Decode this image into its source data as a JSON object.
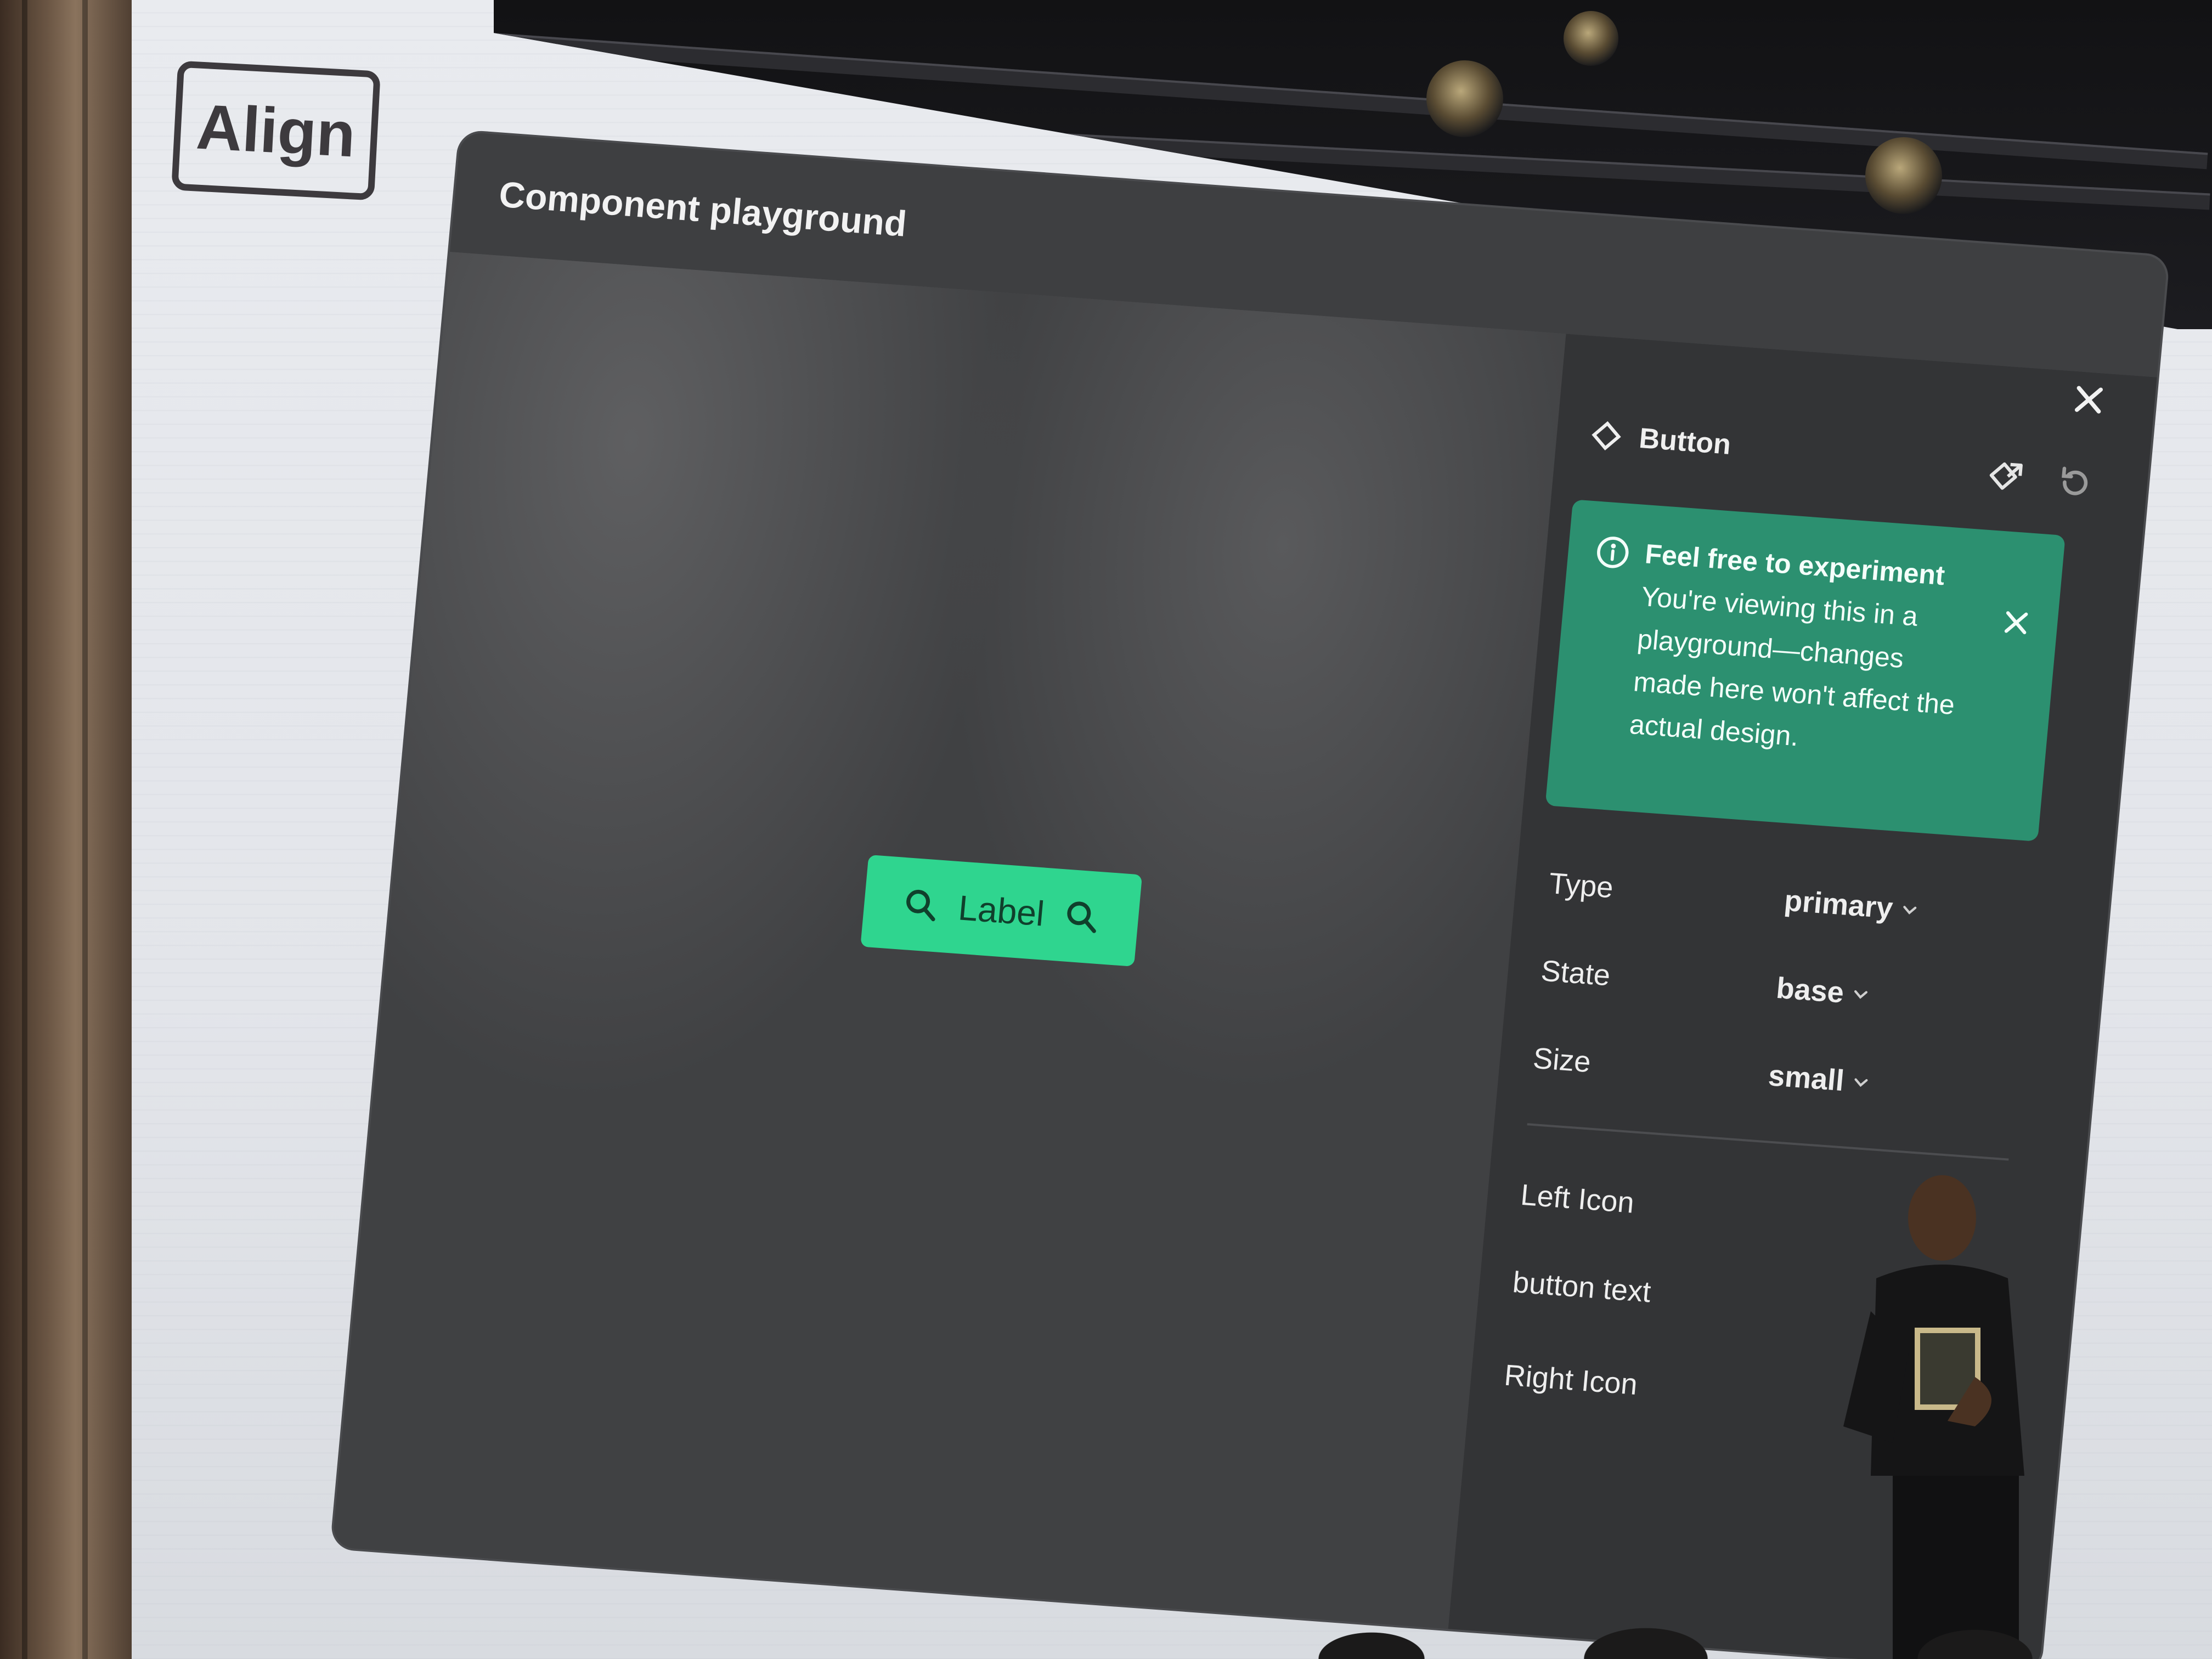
{
  "brand": {
    "logo_text": "Align"
  },
  "window": {
    "title": "Component playground"
  },
  "preview": {
    "button_label": "Label",
    "button_color": "#2fd58f"
  },
  "panel": {
    "component_name": "Button",
    "notice": {
      "title": "Feel free to experiment",
      "body": "You're viewing this in a playground—changes made here won't affect the actual design.",
      "color": "#2c9070"
    },
    "properties": [
      {
        "label": "Type",
        "value": "primary"
      },
      {
        "label": "State",
        "value": "base"
      },
      {
        "label": "Size",
        "value": "small"
      }
    ],
    "content_properties": [
      {
        "label": "Left Icon"
      },
      {
        "label": "button text"
      },
      {
        "label": "Right Icon"
      }
    ]
  },
  "icons": [
    "search-icon",
    "close-icon",
    "component-diamond-icon",
    "go-to-component-icon",
    "reset-icon",
    "info-icon",
    "chevron-down-icon"
  ]
}
